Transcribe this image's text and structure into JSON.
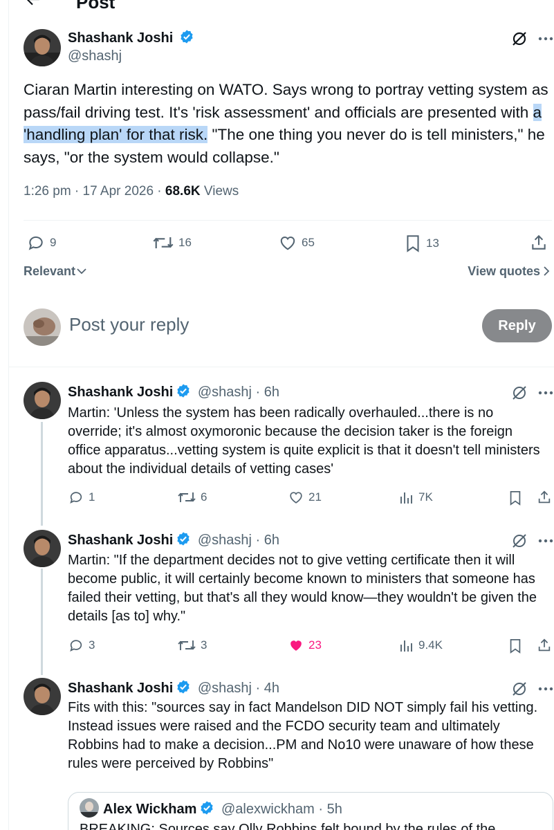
{
  "header": {
    "title": "Post"
  },
  "main_post": {
    "author_name": "Shashank Joshi",
    "author_handle": "@shashj",
    "text_before": "Ciaran Martin interesting on WATO. Says wrong to portray vetting system as pass/fail driving test. It's 'risk assessment' and officials are presented with ",
    "text_highlight": "a 'handling plan' for that risk.",
    "text_after": " \"The one thing you never do is tell ministers,\" he says, \"or the system would collapse.\"",
    "time": "1:26 pm",
    "date": "17 Apr 2026",
    "views_count": "68.6K",
    "views_label": "Views",
    "stats": {
      "replies": "9",
      "reposts": "16",
      "likes": "65",
      "bookmarks": "13"
    }
  },
  "sort": {
    "label": "Relevant",
    "view_quotes": "View quotes"
  },
  "reply_box": {
    "placeholder": "Post your reply",
    "button": "Reply"
  },
  "replies": [
    {
      "author_name": "Shashank Joshi",
      "author_handle": "@shashj",
      "age": "6h",
      "text": "Martin: 'Unless the system has been radically overhauled...there is no override; it's almost oxymoronic because the decision taker is the foreign office apparatus...vetting system is quite explicit is that it doesn't tell ministers about the individual details of vetting cases'",
      "stats": {
        "replies": "1",
        "reposts": "6",
        "likes": "21",
        "views": "7K"
      }
    },
    {
      "author_name": "Shashank Joshi",
      "author_handle": "@shashj",
      "age": "6h",
      "text": "Martin: \"If the department decides not to give vetting certificate then it will become public, it will certainly  become known to ministers that someone has failed their vetting, but that's all they would know—they wouldn't be given the details [as to] why.\"",
      "stats": {
        "replies": "3",
        "reposts": "3",
        "likes": "23",
        "views": "9.4K"
      }
    },
    {
      "author_name": "Shashank Joshi",
      "author_handle": "@shashj",
      "age": "4h",
      "text": "Fits with this: \"sources say in fact Mandelson DID NOT simply fail his vetting. Instead issues were raised and the FCDO security team and ultimately Robbins had to make a decision...PM and No10 were unaware of how these rules were perceived by Robbins\"",
      "quote": {
        "author_name": "Alex Wickham",
        "author_handle": "@alexwickham",
        "age": "5h",
        "text": "BREAKING: Sources say Olly Robbins felt bound by the rules of the"
      }
    }
  ],
  "colors": {
    "accent": "#1d9bf0",
    "like": "#f91880",
    "muted": "#536471",
    "highlight": "#b9d7f7"
  }
}
